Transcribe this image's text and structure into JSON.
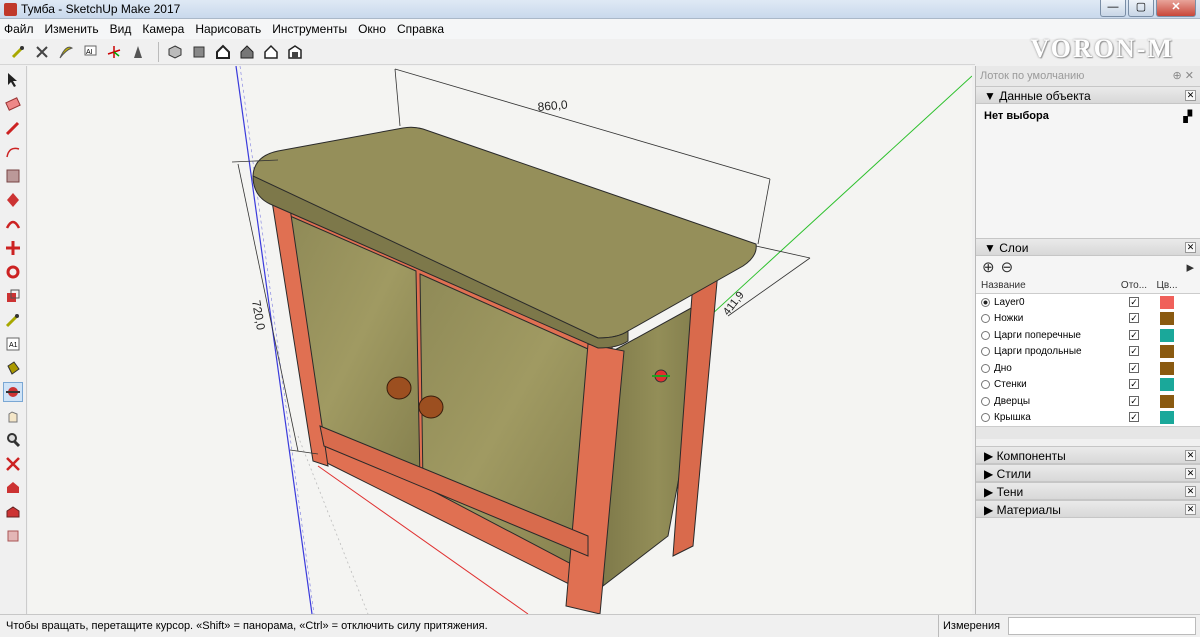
{
  "window": {
    "title": "Тумба - SketchUp Make 2017"
  },
  "menu": [
    "Файл",
    "Изменить",
    "Вид",
    "Камера",
    "Нарисовать",
    "Инструменты",
    "Окно",
    "Справка"
  ],
  "watermark": "VORON-M",
  "viewport": {
    "dim_width": "860,0",
    "dim_height": "720,0",
    "dim_depth": "411,9"
  },
  "tray": {
    "title": "Лоток по умолчанию",
    "entity": {
      "header": "Данные объекта",
      "selection": "Нет выбора"
    },
    "layers": {
      "header": "Слои",
      "col_name": "Название",
      "col_visible": "Ото...",
      "col_color": "Цв...",
      "rows": [
        {
          "name": "Layer0",
          "active": true,
          "color": "#f0605a"
        },
        {
          "name": "Ножки",
          "active": false,
          "color": "#8a5a10"
        },
        {
          "name": "Царги поперечные",
          "active": false,
          "color": "#1aa89a"
        },
        {
          "name": "Царги продольные",
          "active": false,
          "color": "#8a5a10"
        },
        {
          "name": "Дно",
          "active": false,
          "color": "#8a5a10"
        },
        {
          "name": "Стенки",
          "active": false,
          "color": "#1aa89a"
        },
        {
          "name": "Дверцы",
          "active": false,
          "color": "#8a5a10"
        },
        {
          "name": "Крышка",
          "active": false,
          "color": "#1aa89a"
        }
      ]
    },
    "collapsed": [
      "Компоненты",
      "Стили",
      "Тени",
      "Материалы"
    ]
  },
  "status": {
    "message": "Чтобы вращать, перетащите курсор. «Shift» = панорама, «Ctrl» = отключить силу притяжения.",
    "measurements_label": "Измерения"
  }
}
